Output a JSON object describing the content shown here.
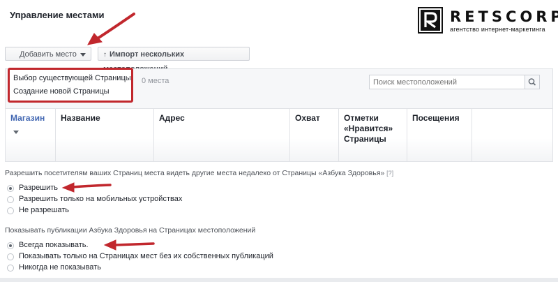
{
  "page": {
    "title": "Управление местами"
  },
  "logo": {
    "letter": "R",
    "name": "RETSCORP",
    "tagline": "агентство интернет-маркетинга"
  },
  "toolbar": {
    "add_label": "Добавить место",
    "import_label": "Импорт нескольких местоположений"
  },
  "dropdown": {
    "items": [
      {
        "label": "Выбор существующей Страницы"
      },
      {
        "label": "Создание новой Страницы"
      }
    ]
  },
  "list": {
    "count": "0 места",
    "search_placeholder": "Поиск местоположений"
  },
  "table": {
    "columns": [
      {
        "label": "Магазин"
      },
      {
        "label": "Название"
      },
      {
        "label": "Адрес"
      },
      {
        "label": "Охват"
      },
      {
        "label": "Отметки «Нравится» Страницы"
      },
      {
        "label": "Посещения"
      }
    ]
  },
  "settings": {
    "nearby": {
      "question": "Разрешить посетителям ваших Страниц места видеть другие места недалеко от Страницы «Азбука Здоровья»",
      "help": "[?]",
      "options": [
        {
          "label": "Разрешить",
          "selected": true
        },
        {
          "label": "Разрешить только на мобильных устройствах",
          "selected": false
        },
        {
          "label": "Не разрешать",
          "selected": false
        }
      ]
    },
    "posts": {
      "question": "Показывать публикации Азбука Здоровья на Страницах местоположений",
      "options": [
        {
          "label": "Всегда показывать.",
          "selected": true
        },
        {
          "label": "Показывать только на Страницах мест без их собственных публикаций",
          "selected": false
        },
        {
          "label": "Никогда не показывать",
          "selected": false
        }
      ]
    }
  },
  "colors": {
    "accent": "#4267b2",
    "annotation": "#c1272d",
    "panel": "#f6f7f9"
  }
}
